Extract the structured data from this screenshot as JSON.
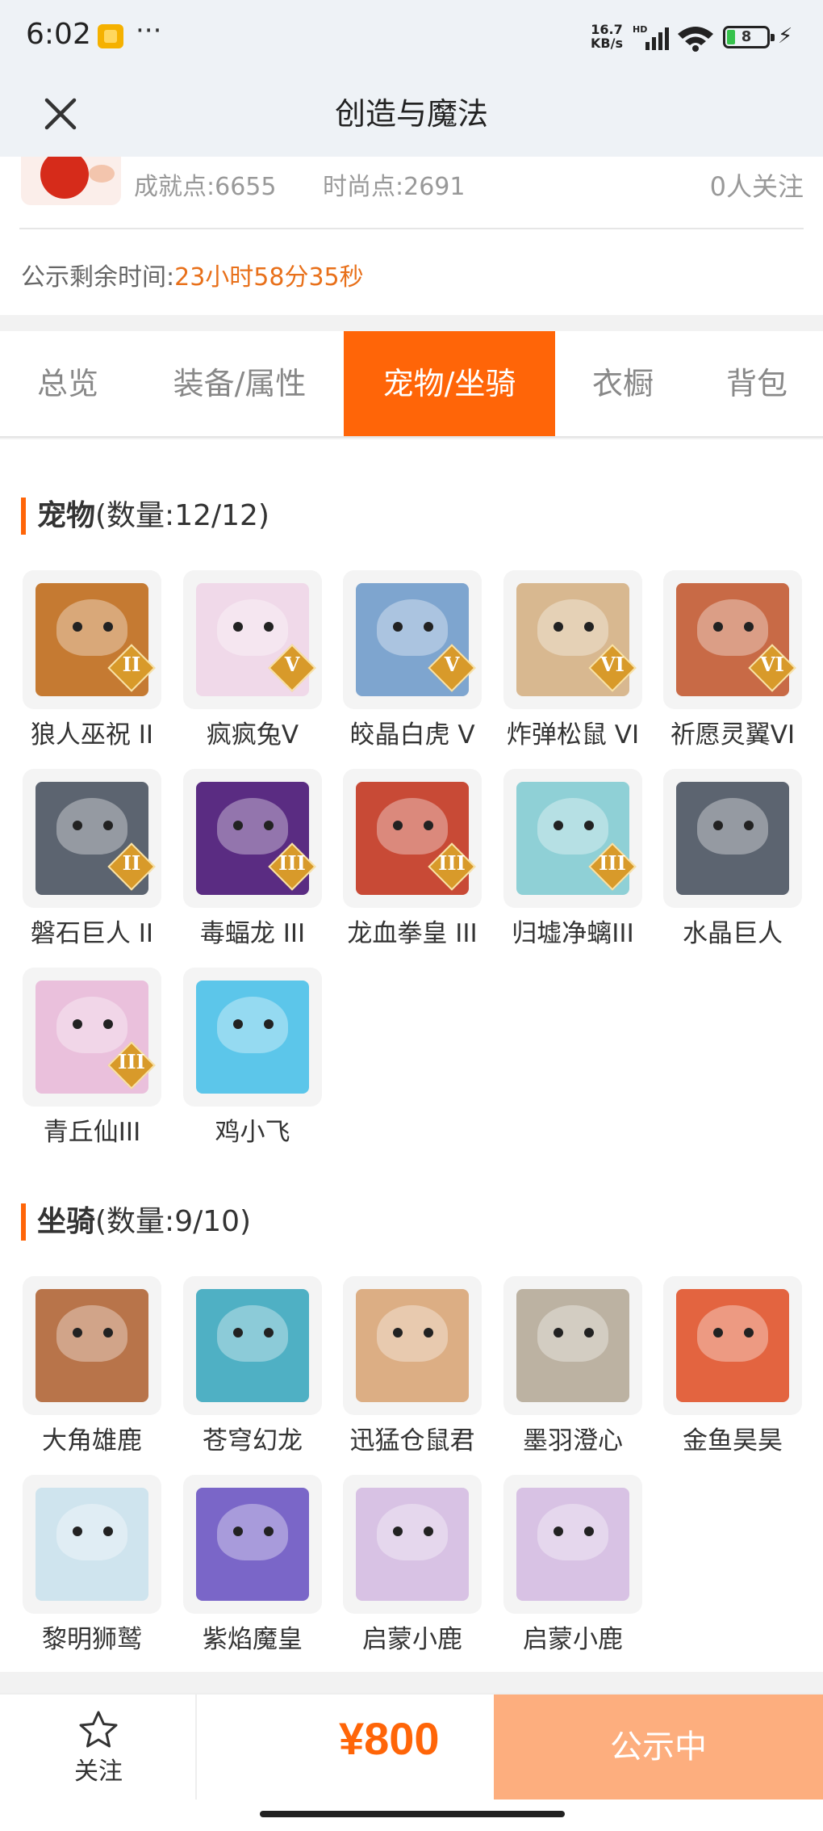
{
  "status_bar": {
    "time": "6:02",
    "more": "···",
    "speed_value": "16.7",
    "speed_unit": "KB/s",
    "hd": "HD",
    "battery": "8"
  },
  "header": {
    "title": "创造与魔法"
  },
  "profile": {
    "achievement": "成就点:6655",
    "fashion": "时尚点:2691",
    "followers": "0人关注"
  },
  "notice": {
    "label": "公示剩余时间:",
    "remaining": "23小时58分35秒"
  },
  "tabs": [
    {
      "label": "总览",
      "active": false
    },
    {
      "label": "装备/属性",
      "active": false
    },
    {
      "label": "宠物/坐骑",
      "active": true
    },
    {
      "label": "衣橱",
      "active": false
    },
    {
      "label": "背包",
      "active": false
    }
  ],
  "pets": {
    "title": "宠物",
    "count": "(数量:12/12)",
    "items": [
      {
        "name": "狼人巫祝 II",
        "badge": "II",
        "color": "#c57a32"
      },
      {
        "name": "疯疯兔V",
        "badge": "V",
        "color": "#f0d9e9"
      },
      {
        "name": "皎晶白虎 V",
        "badge": "V",
        "color": "#7ea5cf"
      },
      {
        "name": "炸弹松鼠 VI",
        "badge": "VI",
        "color": "#d8b890"
      },
      {
        "name": "祈愿灵翼VI",
        "badge": "VI",
        "color": "#c86a46"
      },
      {
        "name": "磐石巨人 II",
        "badge": "II",
        "color": "#5c6470"
      },
      {
        "name": "毒蝠龙 III",
        "badge": "III",
        "color": "#5a2c82"
      },
      {
        "name": "龙血拳皇 III",
        "badge": "III",
        "color": "#c84a36"
      },
      {
        "name": "归墟净螭III",
        "badge": "III",
        "color": "#8fd0d6"
      },
      {
        "name": "水晶巨人",
        "badge": "",
        "color": "#5c6470"
      },
      {
        "name": "青丘仙III",
        "badge": "III",
        "color": "#eac0dc"
      },
      {
        "name": "鸡小飞",
        "badge": "",
        "color": "#5cc6ea"
      }
    ]
  },
  "mounts": {
    "title": "坐骑",
    "count": "(数量:9/10)",
    "items": [
      {
        "name": "大角雄鹿",
        "badge": "",
        "color": "#b8744a"
      },
      {
        "name": "苍穹幻龙",
        "badge": "",
        "color": "#4fb0c4"
      },
      {
        "name": "迅猛仓鼠君",
        "badge": "",
        "color": "#dcae84"
      },
      {
        "name": "墨羽澄心",
        "badge": "",
        "color": "#bcb2a2"
      },
      {
        "name": "金鱼昊昊",
        "badge": "",
        "color": "#e36440"
      },
      {
        "name": "黎明狮鹫",
        "badge": "",
        "color": "#cfe4ee"
      },
      {
        "name": "紫焰魔皇",
        "badge": "",
        "color": "#7a66c8"
      },
      {
        "name": "启蒙小鹿",
        "badge": "",
        "color": "#d8c2e4"
      },
      {
        "name": "启蒙小鹿",
        "badge": "",
        "color": "#d8c2e4"
      }
    ]
  },
  "bottom_bar": {
    "follow_label": "关注",
    "price": "¥800",
    "status_label": "公示中"
  },
  "colors": {
    "accent": "#ff6508",
    "status_button": "#fdae7e"
  }
}
